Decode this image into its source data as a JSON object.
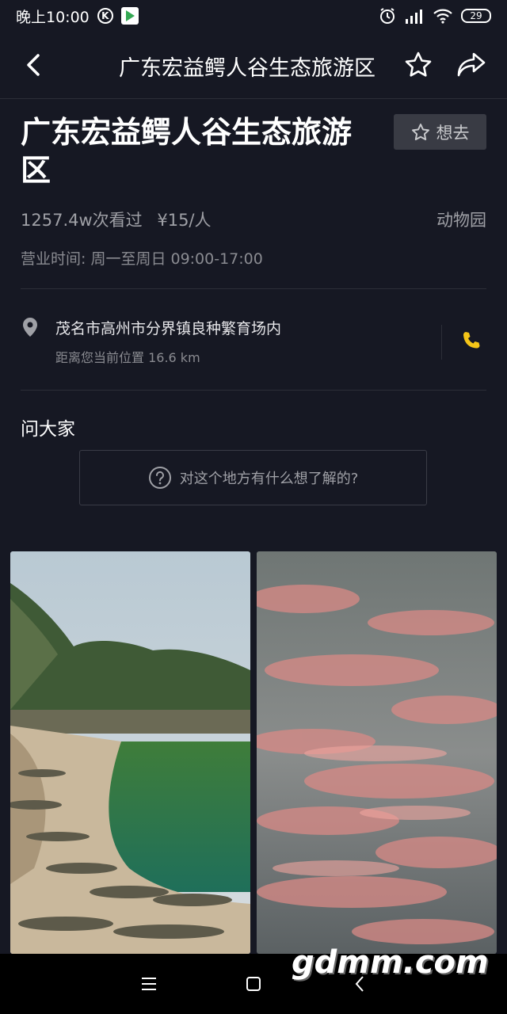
{
  "status_bar": {
    "time": "晚上10:00",
    "badge": "K",
    "battery": "29"
  },
  "nav": {
    "title": "广东宏益鳄人谷生态旅游区"
  },
  "place": {
    "title": "广东宏益鳄人谷生态旅游区",
    "want_label": "想去",
    "views": "1257.4w次看过",
    "price": "¥15/人",
    "category": "动物园",
    "hours": "营业时间: 周一至周日 09:00-17:00",
    "address": "茂名市高州市分界镇良种繁育场内",
    "distance": "距离您当前位置 16.6 km"
  },
  "ask": {
    "title": "问大家",
    "placeholder": "对这个地方有什么想了解的?"
  },
  "watermark": "gdmm.com",
  "colors": {
    "background": "#161823",
    "accent_phone": "#f5c518",
    "secondary_text": "#9fa0a6"
  },
  "icons": [
    "back-icon",
    "star-icon",
    "share-icon",
    "location-pin-icon",
    "phone-icon",
    "question-icon",
    "menu-icon",
    "home-icon",
    "back-triangle-icon"
  ]
}
